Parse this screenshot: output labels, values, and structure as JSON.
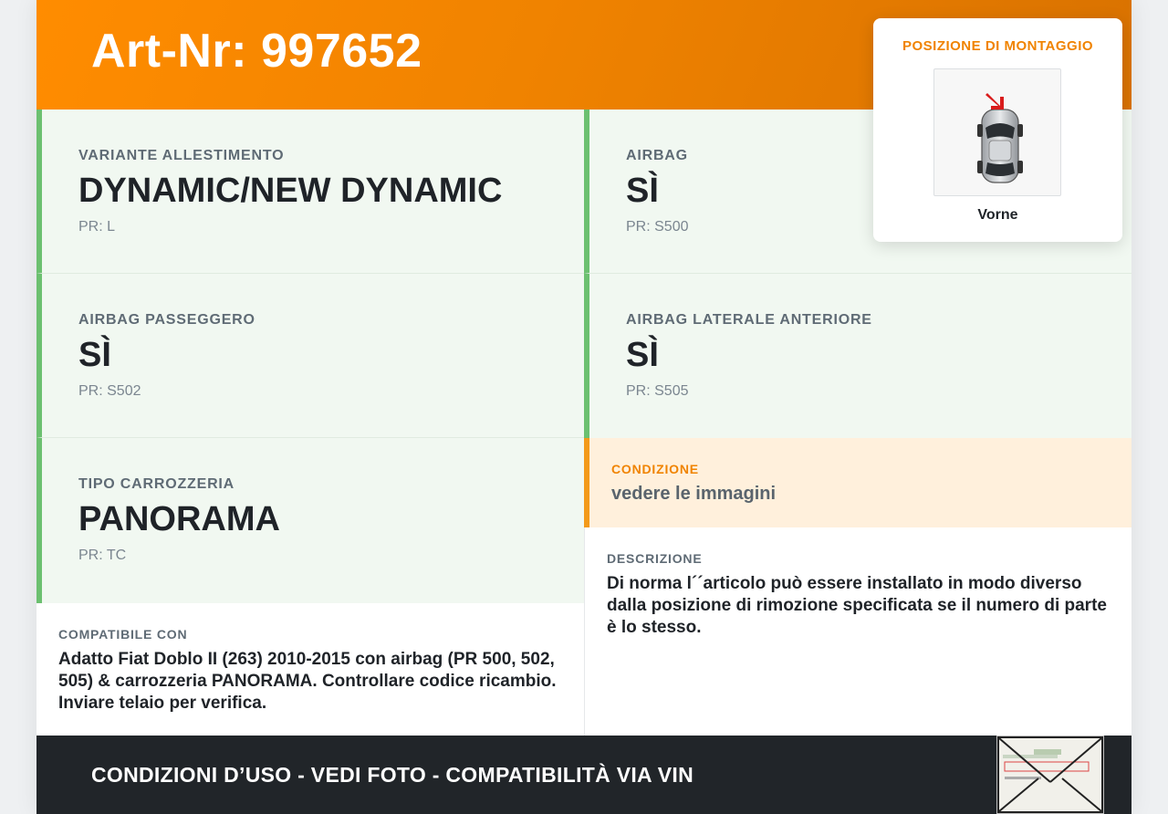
{
  "header": {
    "title": "Art-Nr: 997652"
  },
  "specs": [
    {
      "label": "VARIANTE ALLESTIMENTO",
      "value": "DYNAMIC/NEW DYNAMIC",
      "pr": "PR: L"
    },
    {
      "label": "AIRBAG",
      "value": "SÌ",
      "pr": "PR: S500"
    },
    {
      "label": "AIRBAG PASSEGGERO",
      "value": "SÌ",
      "pr": "PR: S502"
    },
    {
      "label": "AIRBAG LATERALE ANTERIORE",
      "value": "SÌ",
      "pr": "PR: S505"
    },
    {
      "label": "TIPO CARROZZERIA",
      "value": "PANORAMA",
      "pr": "PR: TC"
    }
  ],
  "condition": {
    "label": "CONDIZIONE",
    "value": "vedere le immagini"
  },
  "description": {
    "label": "DESCRIZIONE",
    "text": "Di norma l´´articolo può essere installato in modo diverso dalla posizione di rimozione specificata se il numero di parte è lo stesso."
  },
  "compatibility": {
    "label": "COMPATIBILE CON",
    "text": "Adatto Fiat Doblo II (263) 2010-2015 con airbag (PR 500, 502, 505) & carrozzeria PANORAMA. Controllare codice ricambio. Inviare telaio per verifica."
  },
  "mounting": {
    "title": "POSIZIONE DI MONTAGGIO",
    "caption": "Vorne",
    "icon": "car-top-view-icon"
  },
  "footer": {
    "text": "CONDIZIONI D’USO - VEDI FOTO - COMPATIBILITÀ VIA VIN",
    "icon": "envelope-icon"
  },
  "colors": {
    "accent": "#f08300",
    "green_border": "#6cc070",
    "spec_bg": "#f1f8f1",
    "condition_bg": "#fff0dc",
    "footer_bg": "#212529"
  }
}
